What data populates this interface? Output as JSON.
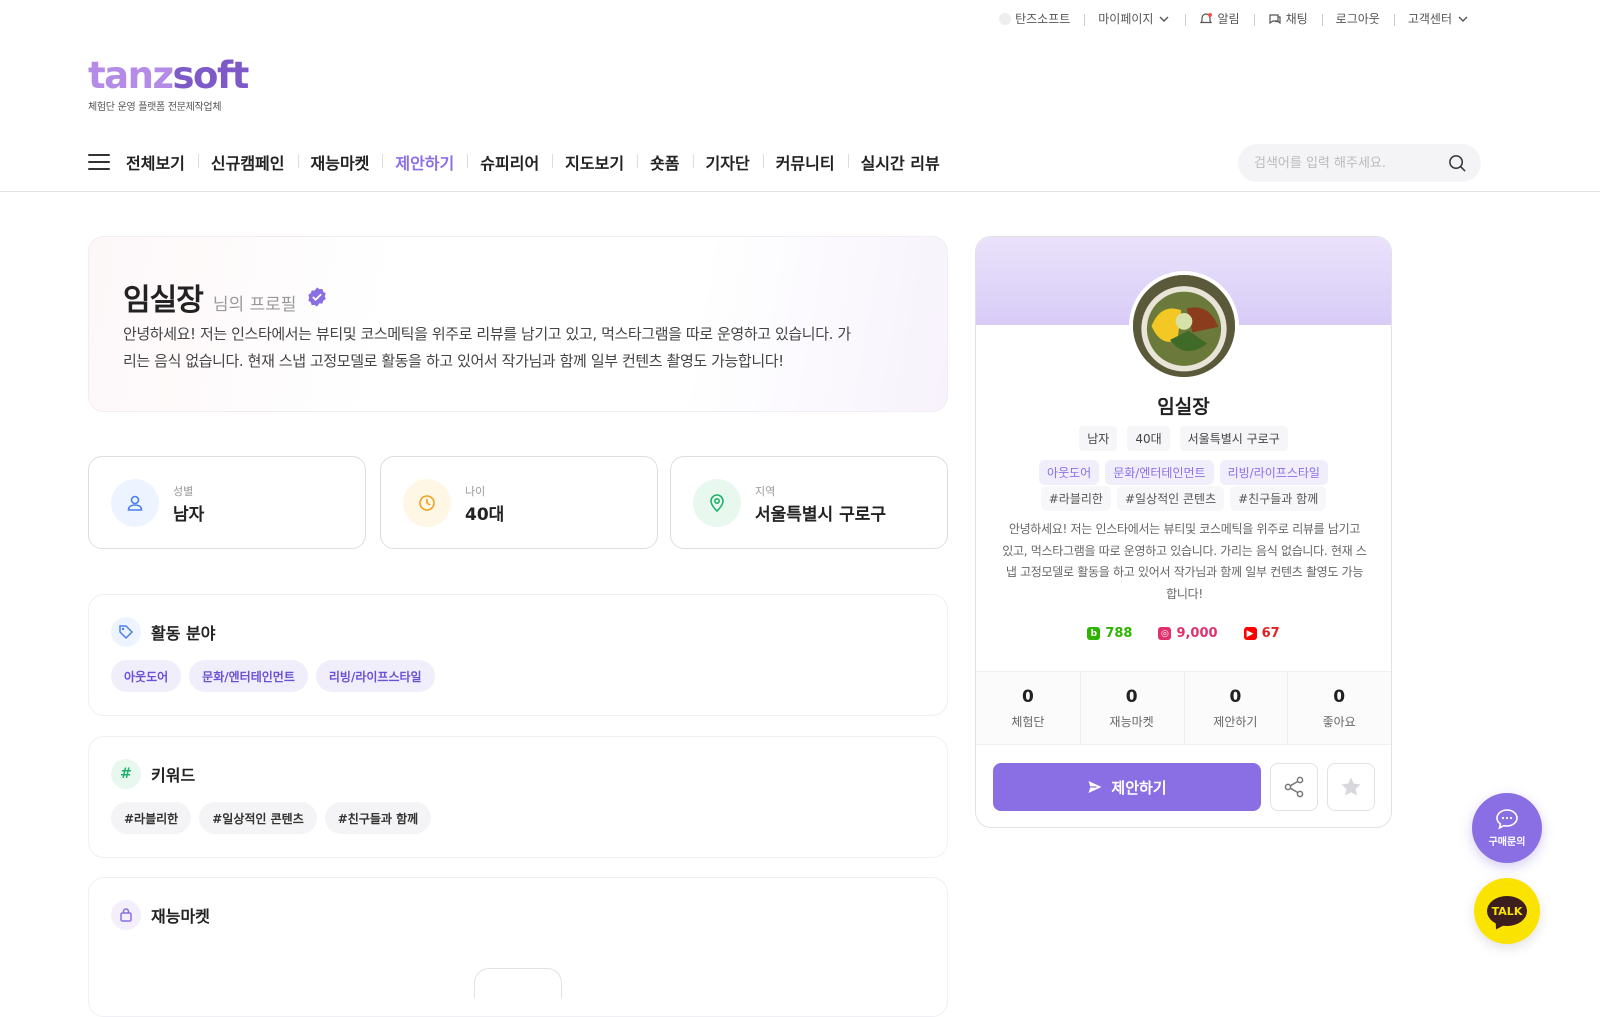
{
  "util_nav": {
    "items": [
      "탄즈소프트",
      "마이페이지",
      "알림",
      "채팅",
      "로그아웃",
      "고객센터"
    ]
  },
  "logo": {
    "wordmark_a": "tanz",
    "wordmark_b": "soft",
    "tagline": "체험단 운영 플랫폼 전문제작업체"
  },
  "gnb": {
    "items": [
      "전체보기",
      "신규캠페인",
      "재능마켓",
      "제안하기",
      "슈피리어",
      "지도보기",
      "숏폼",
      "기자단",
      "커뮤니티",
      "실시간 리뷰"
    ],
    "active": "제안하기"
  },
  "search": {
    "placeholder": "검색어를 입력 해주세요."
  },
  "profile": {
    "name": "임실장",
    "suffix": "님의 프로필",
    "bio": "안녕하세요! 저는 인스타에서는 뷰티및 코스메틱을 위주로 리뷰를 남기고 있고, 먹스타그램을 따로 운영하고 있습니다. 가리는 음식 없습니다. 현재 스냅 고정모델로 활동을 하고 있어서 작가님과 함께 일부 컨텐츠 촬영도 가능합니다!",
    "bio_short": "안녕하세요! 저는 인스타에서는 뷰티및 코스메틱을 위주로 리뷰를 남기고 있고, 먹스타그램을 따로 운영하고 있습니다. 가리는 음식 없습니다. 현재 스냅 고정모델로 활동을 하고 있어서 작가님과 함께 일부 컨텐츠 촬영도 가능합니다!"
  },
  "info": [
    {
      "label": "성별",
      "value": "남자",
      "icon": "user-icon"
    },
    {
      "label": "나이",
      "value": "40대",
      "icon": "clock-icon"
    },
    {
      "label": "지역",
      "value": "서울특별시 구로구",
      "icon": "location-icon"
    }
  ],
  "sections": {
    "activity": {
      "title": "활동 분야",
      "chips": [
        "아웃도어",
        "문화/엔터테인먼트",
        "리빙/라이프스타일"
      ]
    },
    "keywords": {
      "title": "키워드",
      "chips": [
        "#라블리한",
        "#일상적인 콘텐츠",
        "#친구들과 함께"
      ]
    },
    "talent": {
      "title": "재능마켓"
    }
  },
  "side_card": {
    "name": "임실장",
    "meta": [
      "남자",
      "40대",
      "서울특별시 구로구"
    ],
    "categories": [
      "아웃도어",
      "문화/엔터테인먼트",
      "리빙/라이프스타일"
    ],
    "keywords": [
      "#라블리한",
      "#일상적인 콘텐츠",
      "#친구들과 함께"
    ],
    "sns": [
      {
        "name": "blog",
        "count": "788",
        "color": "#2db400"
      },
      {
        "name": "instagram",
        "count": "9,000",
        "color": "#e1306c"
      },
      {
        "name": "youtube",
        "count": "67",
        "color": "#ff0000"
      }
    ],
    "stats": [
      {
        "value": "0",
        "label": "체험단"
      },
      {
        "value": "0",
        "label": "재능마켓"
      },
      {
        "value": "0",
        "label": "제안하기"
      },
      {
        "value": "0",
        "label": "좋아요"
      }
    ],
    "propose_label": "제안하기"
  },
  "floating": {
    "inquiry_label": "구매문의",
    "talk_label": "TALK"
  },
  "colors": {
    "accent": "#8a6ee4",
    "kakao": "#fbe300"
  }
}
